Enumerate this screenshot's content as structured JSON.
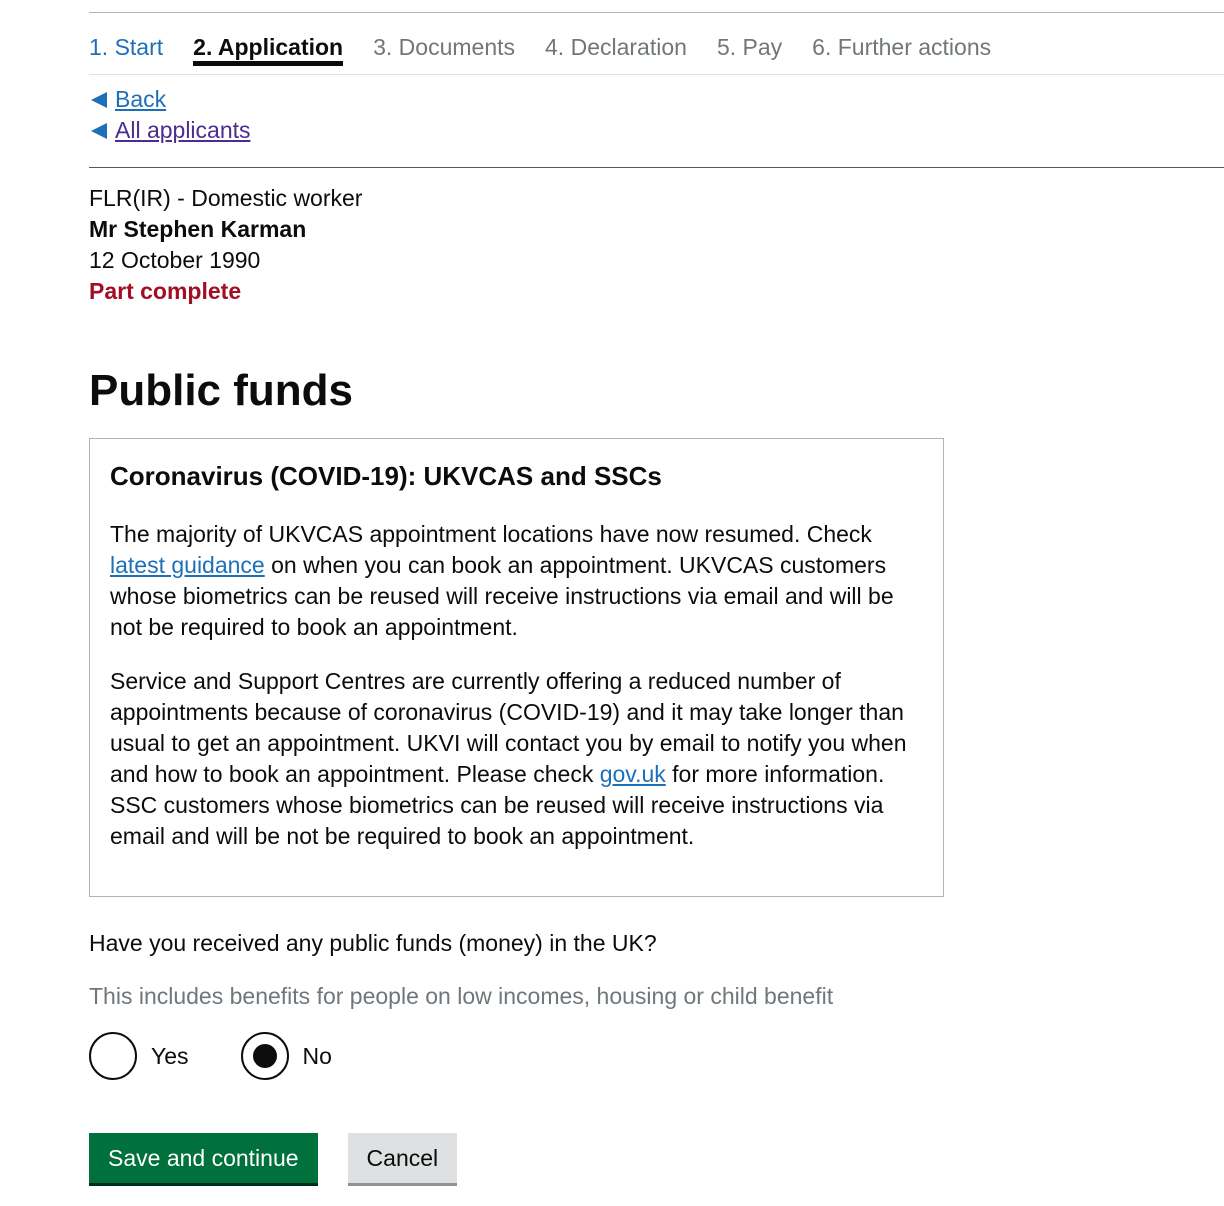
{
  "steps": [
    {
      "label": "1. Start",
      "state": "done"
    },
    {
      "label": "2. Application",
      "state": "current"
    },
    {
      "label": "3. Documents",
      "state": "upcoming"
    },
    {
      "label": "4. Declaration",
      "state": "upcoming"
    },
    {
      "label": "5. Pay",
      "state": "upcoming"
    },
    {
      "label": "6. Further actions",
      "state": "upcoming"
    }
  ],
  "nav": {
    "back_label": "Back",
    "all_applicants_label": "All applicants"
  },
  "applicant": {
    "application_type": "FLR(IR) - Domestic worker",
    "name": "Mr Stephen Karman",
    "dob": "12 October 1990",
    "status": "Part complete"
  },
  "page_title": "Public funds",
  "notice": {
    "title": "Coronavirus (COVID-19): UKVCAS and SSCs",
    "p1_before": "The majority of UKVCAS appointment locations have now resumed. Check ",
    "p1_link": "latest guidance",
    "p1_after": " on when you can book an appointment. UKVCAS customers whose biometrics can be reused will receive instructions via email and will be not be required to book an appointment.",
    "p2_before": "Service and Support Centres are currently offering a reduced number of appointments because of coronavirus (COVID-19) and it may take longer than usual to get an appointment. UKVI will contact you by email to notify you when and how to book an appointment. Please check ",
    "p2_link": "gov.uk",
    "p2_after": " for more information. SSC customers whose biometrics can be reused will receive instructions via email and will be not be required to book an appointment."
  },
  "question": {
    "label": "Have you received any public funds (money) in the UK?",
    "hint": "This includes benefits for people on low incomes, housing or child benefit",
    "options": [
      {
        "label": "Yes",
        "checked": false
      },
      {
        "label": "No",
        "checked": true
      }
    ]
  },
  "actions": {
    "save_label": "Save and continue",
    "cancel_label": "Cancel"
  },
  "colors": {
    "link": "#1d70b8",
    "visited_link": "#4c2c92",
    "status_red": "#a10f24",
    "primary_button": "#00703c",
    "secondary_button": "#dfe0e1"
  }
}
